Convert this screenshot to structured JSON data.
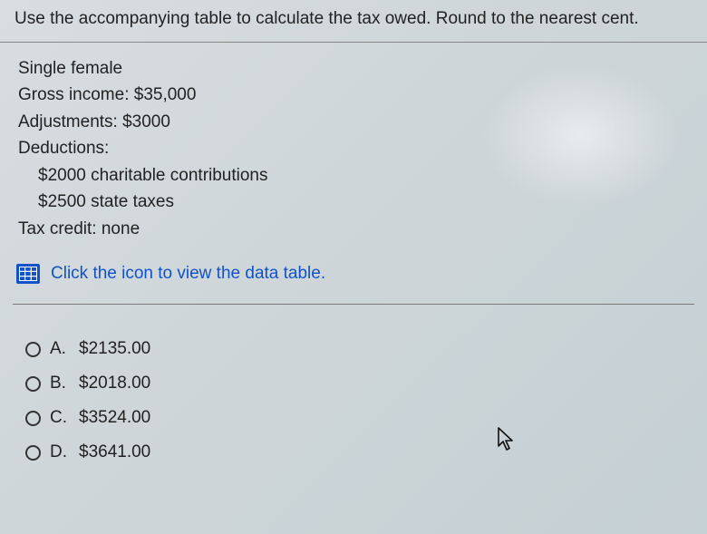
{
  "question": {
    "prompt": "Use the accompanying table to calculate the tax owed. Round to the nearest cent.",
    "lines": {
      "filing": "Single female",
      "gross": "Gross income: $35,000",
      "adjustments": "Adjustments: $3000",
      "deductions_label": "Deductions:",
      "ded1": "$2000 charitable contributions",
      "ded2": "$2500 state taxes",
      "credit": "Tax credit: none"
    },
    "data_link": "Click the icon to view the data table."
  },
  "answers": [
    {
      "letter": "A.",
      "value": "$2135.00"
    },
    {
      "letter": "B.",
      "value": "$2018.00"
    },
    {
      "letter": "C.",
      "value": "$3524.00"
    },
    {
      "letter": "D.",
      "value": "$3641.00"
    }
  ]
}
